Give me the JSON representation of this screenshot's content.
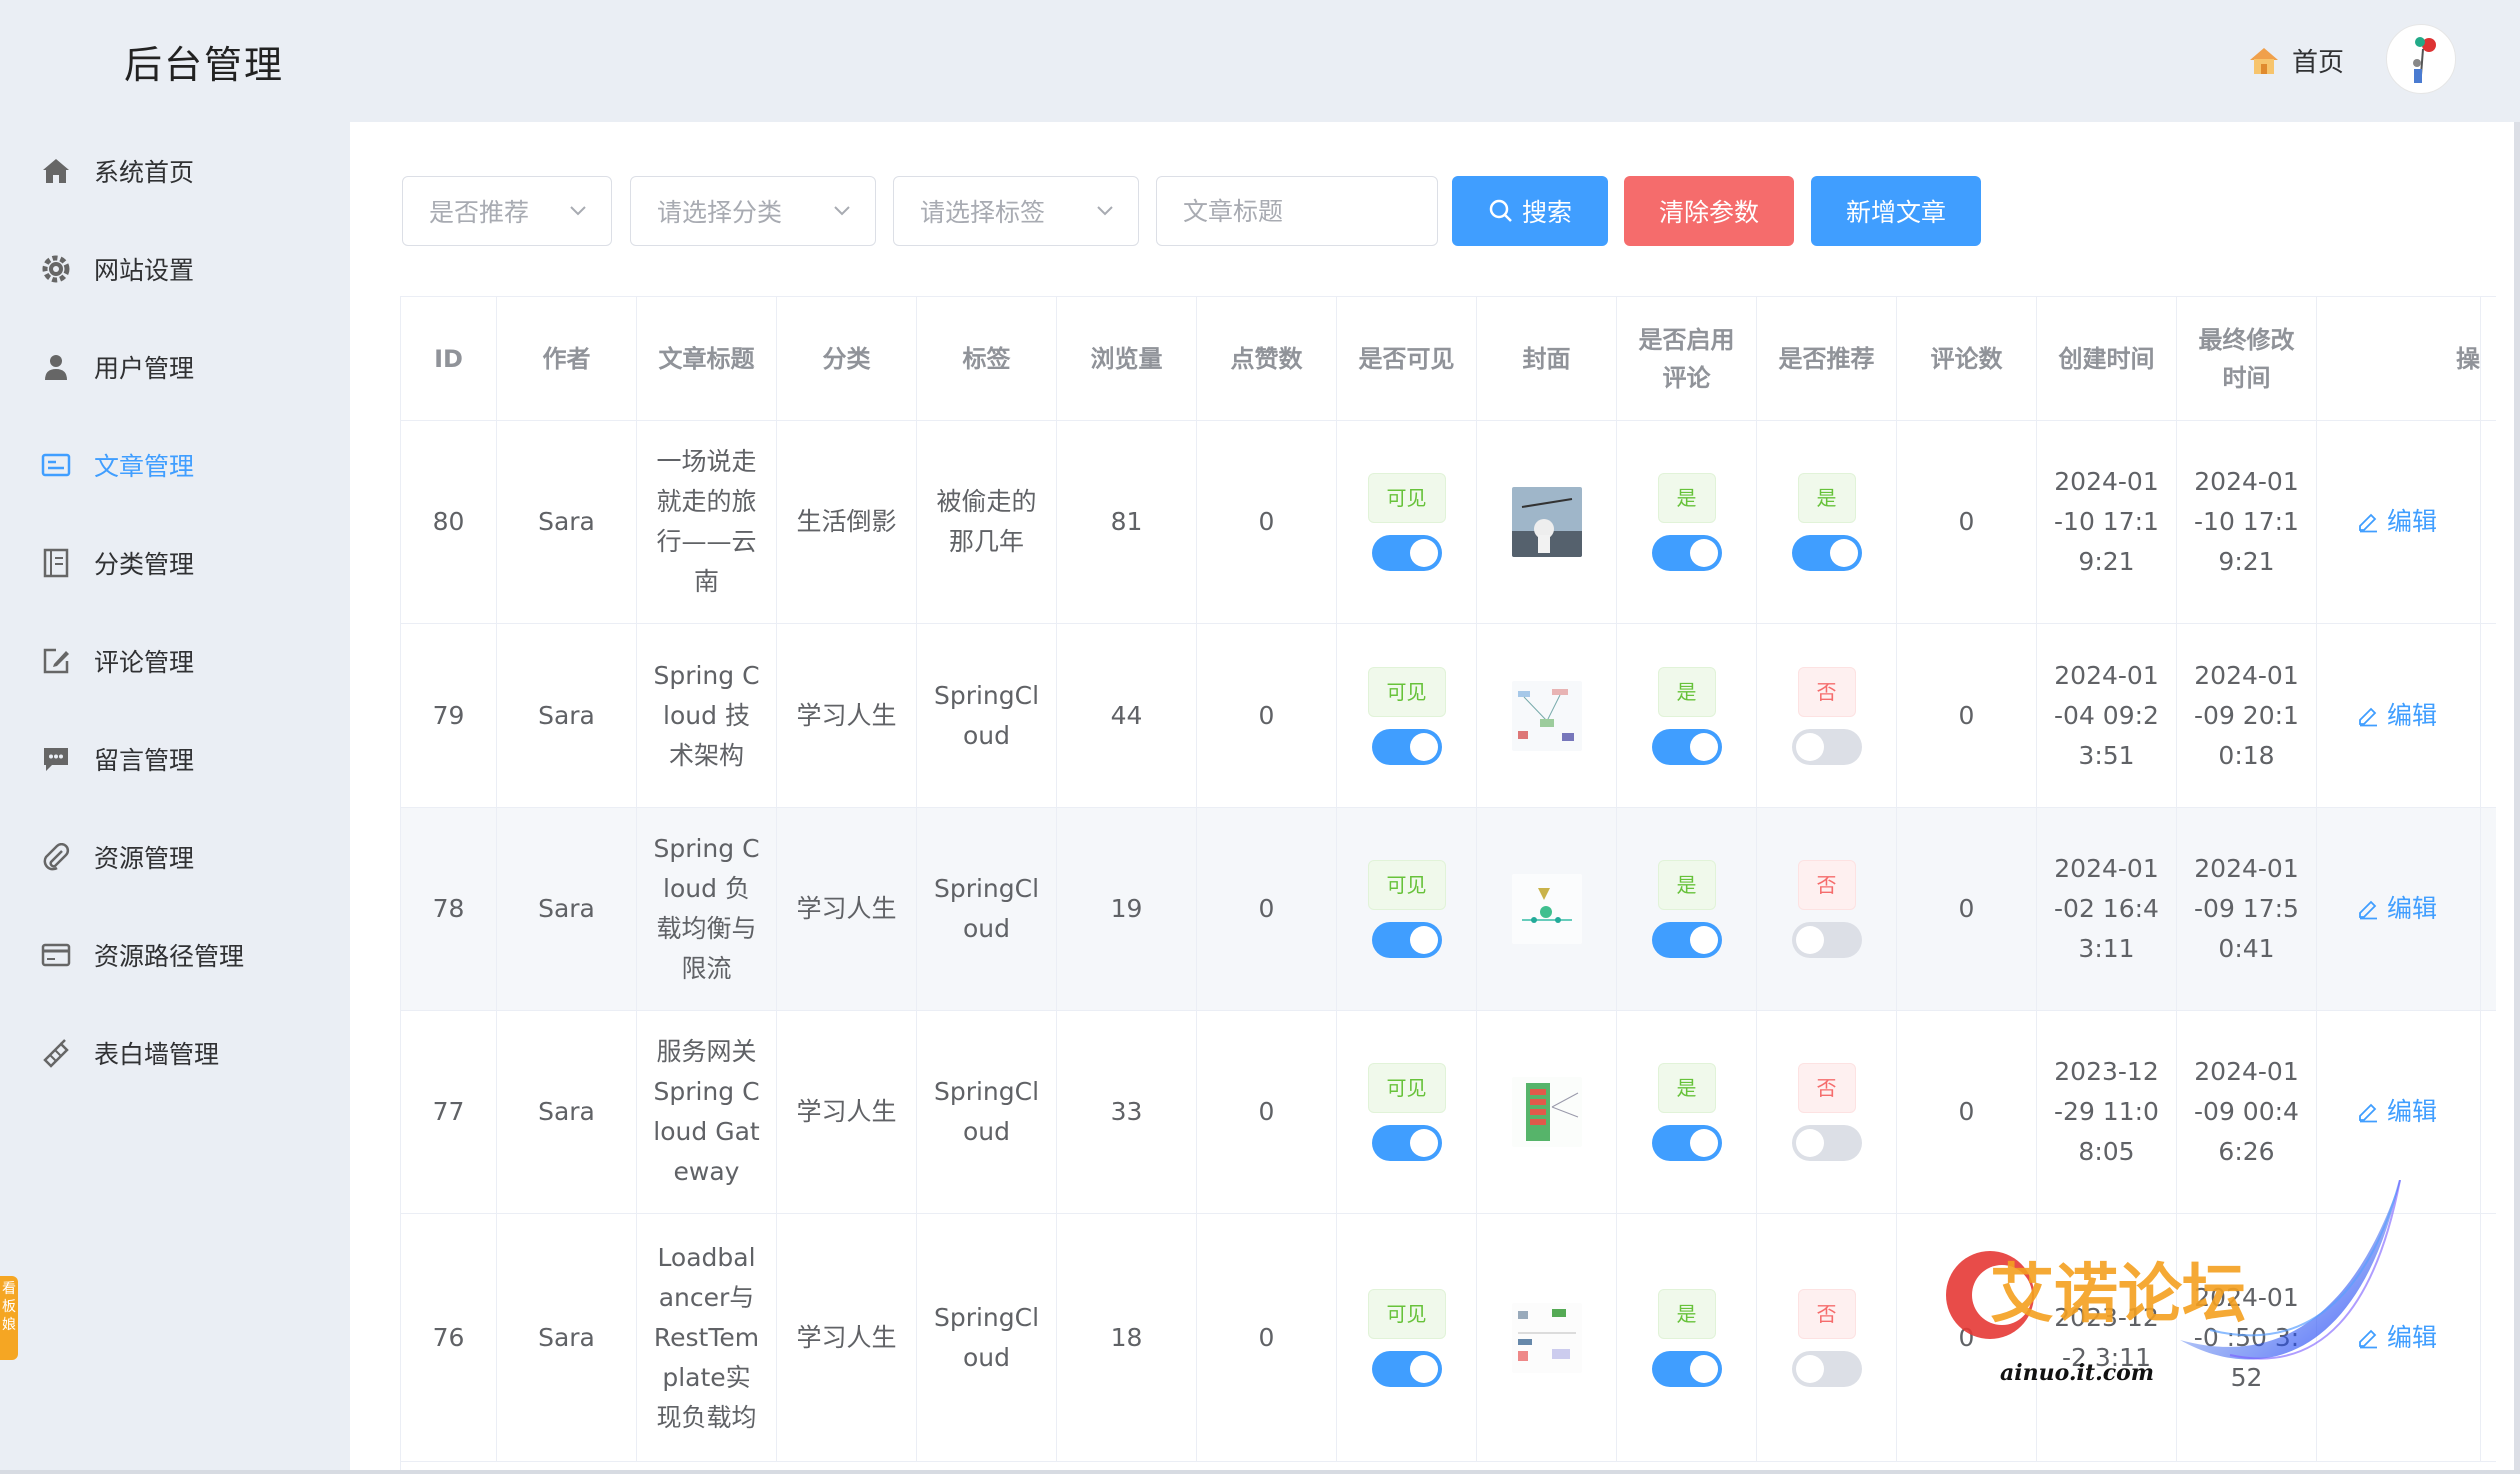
{
  "header": {
    "title": "后台管理",
    "home_label": "首页",
    "home_icon": "house-icon",
    "avatar_icon": "user-avatar"
  },
  "sidebar": {
    "items": [
      {
        "label": "系统首页",
        "icon": "home-icon"
      },
      {
        "label": "网站设置",
        "icon": "gear-icon"
      },
      {
        "label": "用户管理",
        "icon": "user-icon"
      },
      {
        "label": "文章管理",
        "icon": "article-icon",
        "active": true
      },
      {
        "label": "分类管理",
        "icon": "category-icon"
      },
      {
        "label": "评论管理",
        "icon": "comment-edit-icon"
      },
      {
        "label": "留言管理",
        "icon": "message-icon"
      },
      {
        "label": "资源管理",
        "icon": "paperclip-icon"
      },
      {
        "label": "资源路径管理",
        "icon": "card-icon"
      },
      {
        "label": "表白墙管理",
        "icon": "wall-icon"
      }
    ],
    "active_color": "#409eff"
  },
  "filters": {
    "recommend_placeholder": "是否推荐",
    "category_placeholder": "请选择分类",
    "tag_placeholder": "请选择标签",
    "title_placeholder": "文章标题",
    "search_label": "搜索",
    "clear_label": "清除参数",
    "add_label": "新增文章"
  },
  "table": {
    "columns": [
      "ID",
      "作者",
      "文章标题",
      "分类",
      "标签",
      "浏览量",
      "点赞数",
      "是否可见",
      "封面",
      "是否启用评论",
      "是否推荐",
      "评论数",
      "创建时间",
      "最终修改时间",
      "操作"
    ],
    "column_visible_text": [
      "ID",
      "作者",
      "文章标题",
      "分类",
      "标签",
      "浏览量",
      "点赞数",
      "是否可见",
      "封面",
      "是否启用\n评论",
      "是否推荐",
      "评论数",
      "创建时间",
      "最终修改\n时间",
      "操"
    ],
    "edit_label": "编辑",
    "rows": [
      {
        "id": "80",
        "author": "Sara",
        "title": "一场说走就走的旅行——云南",
        "category": "生活倒影",
        "tag": "被偷走的那几年",
        "views": "81",
        "likes": "0",
        "visible": "可见",
        "visible_on": true,
        "comments_enabled": "是",
        "comments_on": true,
        "recommend": "是",
        "recommend_on": true,
        "comment_count": "0",
        "created": "2024-01-10 17:19:21",
        "modified": "2024-01-10 17:19:21"
      },
      {
        "id": "79",
        "author": "Sara",
        "title": "Spring Cloud 技术架构",
        "category": "学习人生",
        "tag": "SpringCloud",
        "views": "44",
        "likes": "0",
        "visible": "可见",
        "visible_on": true,
        "comments_enabled": "是",
        "comments_on": true,
        "recommend": "否",
        "recommend_on": false,
        "comment_count": "0",
        "created": "2024-01-04 09:23:51",
        "modified": "2024-01-09 20:10:18"
      },
      {
        "id": "78",
        "author": "Sara",
        "title": "Spring Cloud 负载均衡与限流",
        "category": "学习人生",
        "tag": "SpringCloud",
        "views": "19",
        "likes": "0",
        "visible": "可见",
        "visible_on": true,
        "comments_enabled": "是",
        "comments_on": true,
        "recommend": "否",
        "recommend_on": false,
        "comment_count": "0",
        "created": "2024-01-02 16:43:11",
        "modified": "2024-01-09 17:50:41"
      },
      {
        "id": "77",
        "author": "Sara",
        "title": "服务网关Spring Cloud Gateway",
        "category": "学习人生",
        "tag": "SpringCloud",
        "views": "33",
        "likes": "0",
        "visible": "可见",
        "visible_on": true,
        "comments_enabled": "是",
        "comments_on": true,
        "recommend": "否",
        "recommend_on": false,
        "comment_count": "0",
        "created": "2023-12-29 11:08:05",
        "modified": "2024-01-09 00:46:26"
      },
      {
        "id": "76",
        "author": "Sara",
        "title": "Loadbalancer与RestTemplate实现负载均",
        "category": "学习人生",
        "tag": "SpringCloud",
        "views": "18",
        "likes": "0",
        "visible": "可见",
        "visible_on": true,
        "comments_enabled": "是",
        "comments_on": true,
        "recommend": "否",
        "recommend_on": false,
        "comment_count": "0",
        "created": "2023-12-2  3:11",
        "modified": "2024-01-0  :50  3:52"
      }
    ]
  },
  "watermark": {
    "text": "艾诺论坛",
    "url": "ainuo.it.com"
  },
  "side_badge": "看板娘",
  "colors": {
    "primary": "#409eff",
    "danger": "#f56c6c",
    "success": "#67c23a",
    "bg": "#eaeef4"
  }
}
